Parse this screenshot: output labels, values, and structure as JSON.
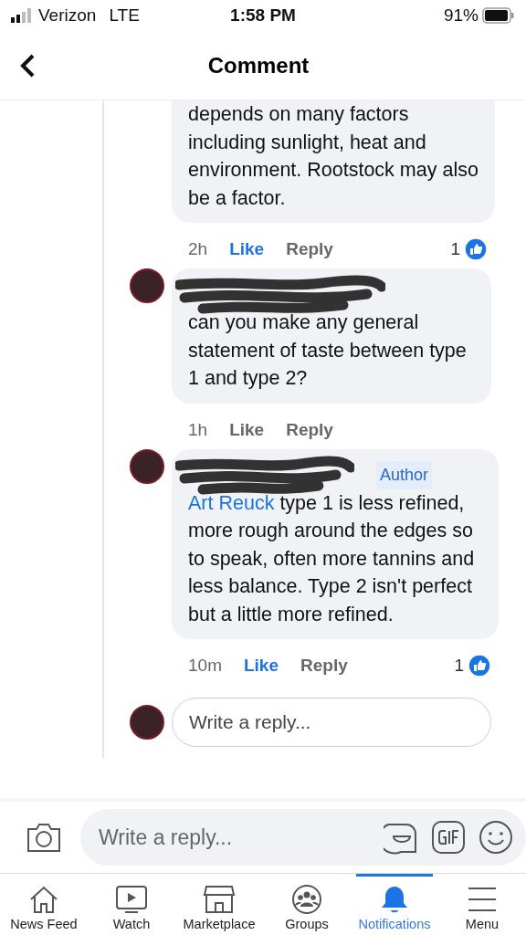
{
  "status_bar": {
    "carrier": "Verizon",
    "network": "LTE",
    "time": "1:58 PM",
    "battery": "91%"
  },
  "header": {
    "title": "Comment"
  },
  "comments": [
    {
      "redacted_name": false,
      "text": "depends on many factors including sunlight, heat and environment.  Rootstock may also be a factor.",
      "time": "2h",
      "like": "Like",
      "liked": true,
      "reply": "Reply",
      "reactions": "1"
    },
    {
      "redacted_name": true,
      "text": "can you make any general statement of taste between type 1 and type 2?",
      "time": "1h",
      "like": "Like",
      "liked": false,
      "reply": "Reply"
    },
    {
      "redacted_name": true,
      "badge": "Author",
      "mention": "Art Reuck",
      "text": "type 1 is less refined, more rough around the edges so to speak, often more tannins and less balance.  Type 2 isn't perfect but a little more refined.",
      "time": "10m",
      "like": "Like",
      "liked": true,
      "reply": "Reply",
      "reactions": "1"
    }
  ],
  "thread_reply": {
    "placeholder": "Write a reply..."
  },
  "composer": {
    "placeholder": "Write a reply..."
  },
  "tabs": [
    {
      "kind": "home",
      "label": "News Feed",
      "selected": false
    },
    {
      "kind": "watch",
      "label": "Watch",
      "selected": false
    },
    {
      "kind": "shop",
      "label": "Marketplace",
      "selected": false
    },
    {
      "kind": "groups",
      "label": "Groups",
      "selected": false
    },
    {
      "kind": "bell",
      "label": "Notifications",
      "selected": true
    },
    {
      "kind": "menu",
      "label": "Menu",
      "selected": false
    }
  ]
}
